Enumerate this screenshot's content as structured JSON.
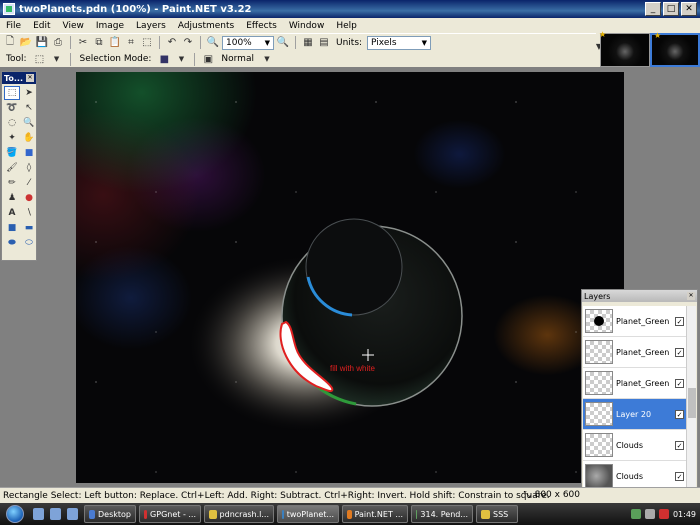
{
  "window": {
    "title": "twoPlanets.pdn (100%) - Paint.NET v3.22",
    "min": "_",
    "max": "□",
    "close": "✕"
  },
  "menu": [
    "File",
    "Edit",
    "View",
    "Image",
    "Layers",
    "Adjustments",
    "Effects",
    "Window",
    "Help"
  ],
  "toolbar": {
    "zoom_value": "100%",
    "units_label": "Units:",
    "units_value": "Pixels"
  },
  "toolbar2": {
    "tool_label": "Tool:",
    "selection_mode_label": "Selection Mode:",
    "blend_value": "Normal"
  },
  "tools_palette": {
    "title": "To..."
  },
  "canvas": {
    "annotation": "fill with white"
  },
  "status": {
    "hint": "Rectangle Select: Left button: Replace. Ctrl+Left: Add. Right: Subtract. Ctrl+Right: Invert. Hold shift: Constrain to square.",
    "image_size": "800 x 600"
  },
  "layers_panel": {
    "title": "Layers",
    "layers": [
      {
        "name": "Planet_Green",
        "thumb": "planet",
        "visible": true,
        "selected": false
      },
      {
        "name": "Planet_Green",
        "thumb": "blank",
        "visible": true,
        "selected": false
      },
      {
        "name": "Planet_Green",
        "thumb": "blank",
        "visible": true,
        "selected": false
      },
      {
        "name": "Layer 20",
        "thumb": "blank",
        "visible": true,
        "selected": true
      },
      {
        "name": "Clouds",
        "thumb": "blank",
        "visible": true,
        "selected": false
      },
      {
        "name": "Clouds",
        "thumb": "clouds",
        "visible": true,
        "selected": false
      }
    ]
  },
  "taskbar": {
    "buttons": [
      {
        "label": "Desktop",
        "color": "#4a7bd0"
      },
      {
        "label": "GPGnet - ...",
        "color": "#d03030"
      },
      {
        "label": "pdncrash.l...",
        "color": "#e0c040"
      },
      {
        "label": "twoPlanet...",
        "color": "#3a80c0"
      },
      {
        "label": "Paint.NET ...",
        "color": "#e07a20"
      },
      {
        "label": "314. Pend...",
        "color": "#60a060"
      },
      {
        "label": "SSS",
        "color": "#e0c040"
      }
    ],
    "clock": "01:49"
  }
}
